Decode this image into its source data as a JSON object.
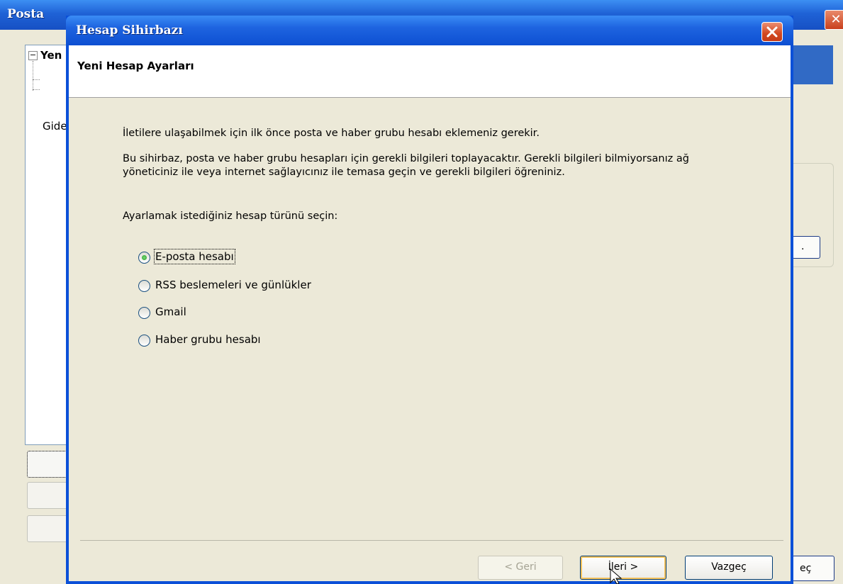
{
  "background_window": {
    "title": "Posta",
    "close_glyph": "✕",
    "tree_root_label": "Yen",
    "tree_expander": "−",
    "side_text": "Gide",
    "dots_button": ".",
    "bottom_button_fragment": "eç"
  },
  "wizard": {
    "title": "Hesap Sihirbazı",
    "header_title": "Yeni Hesap Ayarları",
    "intro_line1": "İletilere ulaşabilmek için ilk önce posta ve haber grubu hesabı eklemeniz gerekir.",
    "intro_line2": "Bu sihirbaz, posta ve haber grubu hesapları için gerekli bilgileri toplayacaktır. Gerekli bilgileri bilmiyorsanız ağ yöneticiniz ile veya internet sağlayıcınız ile temasa geçin ve gerekli bilgileri öğreniniz.",
    "prompt": "Ayarlamak istediğiniz hesap türünü seçin:",
    "account_types": [
      {
        "label": "E-posta hesabı",
        "selected": true
      },
      {
        "label": "RSS beslemeleri ve günlükler",
        "selected": false
      },
      {
        "label": "Gmail",
        "selected": false
      },
      {
        "label": "Haber grubu hesabı",
        "selected": false
      }
    ],
    "buttons": {
      "back": "< Geri",
      "next": "İleri >",
      "cancel": "Vazgeç"
    }
  },
  "colors": {
    "titlebar_blue": "#0b50d8",
    "dialog_face": "#ece9d8",
    "radio_selected": "#21a121",
    "close_red": "#d2471f"
  }
}
